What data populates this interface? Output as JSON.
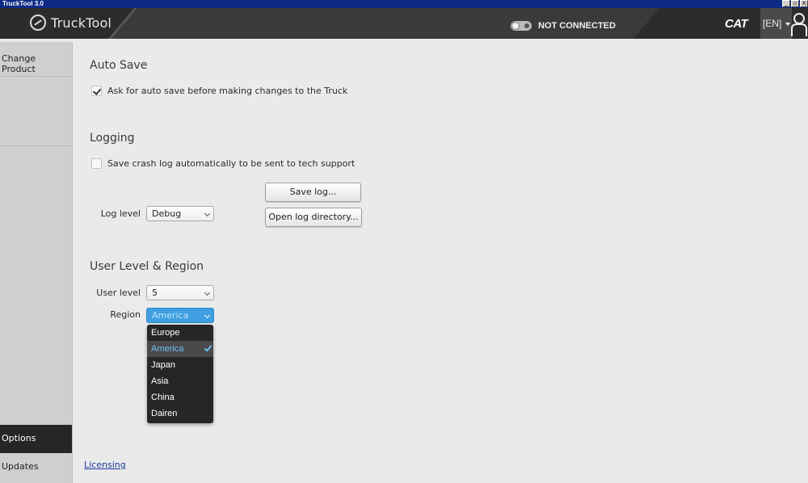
{
  "window": {
    "title": "TruckTool 3.0",
    "buttons": [
      "_",
      "▫",
      "X"
    ]
  },
  "header": {
    "app_name": "TruckTool",
    "connection_status": "NOT CONNECTED",
    "brand": "CAT",
    "language": "[EN]"
  },
  "sidebar": {
    "items": [
      {
        "label": "Change Product"
      },
      {
        "label": "Options",
        "active": true
      },
      {
        "label": "Updates"
      }
    ]
  },
  "auto_save": {
    "title": "Auto Save",
    "checkbox_label": "Ask for auto save before making changes to the Truck",
    "checked": true
  },
  "logging": {
    "title": "Logging",
    "checkbox_label": "Save crash log automatically to be sent to tech support",
    "checked": false,
    "save_button": "Save log...",
    "open_button": "Open log directory...",
    "log_level_label": "Log level",
    "log_level_value": "Debug"
  },
  "user_region": {
    "title": "User Level & Region",
    "user_level_label": "User level",
    "user_level_value": "5",
    "region_label": "Region",
    "region_value": "America",
    "region_options": [
      "Europe",
      "America",
      "Japan",
      "Asia",
      "China",
      "Dairen"
    ],
    "region_selected_index": 1
  },
  "footer": {
    "licensing_link": "Licensing"
  },
  "colors": {
    "accent": "#3f9fe0",
    "header_bg": "#2c2c2c",
    "sidebar_active": "#262626"
  }
}
